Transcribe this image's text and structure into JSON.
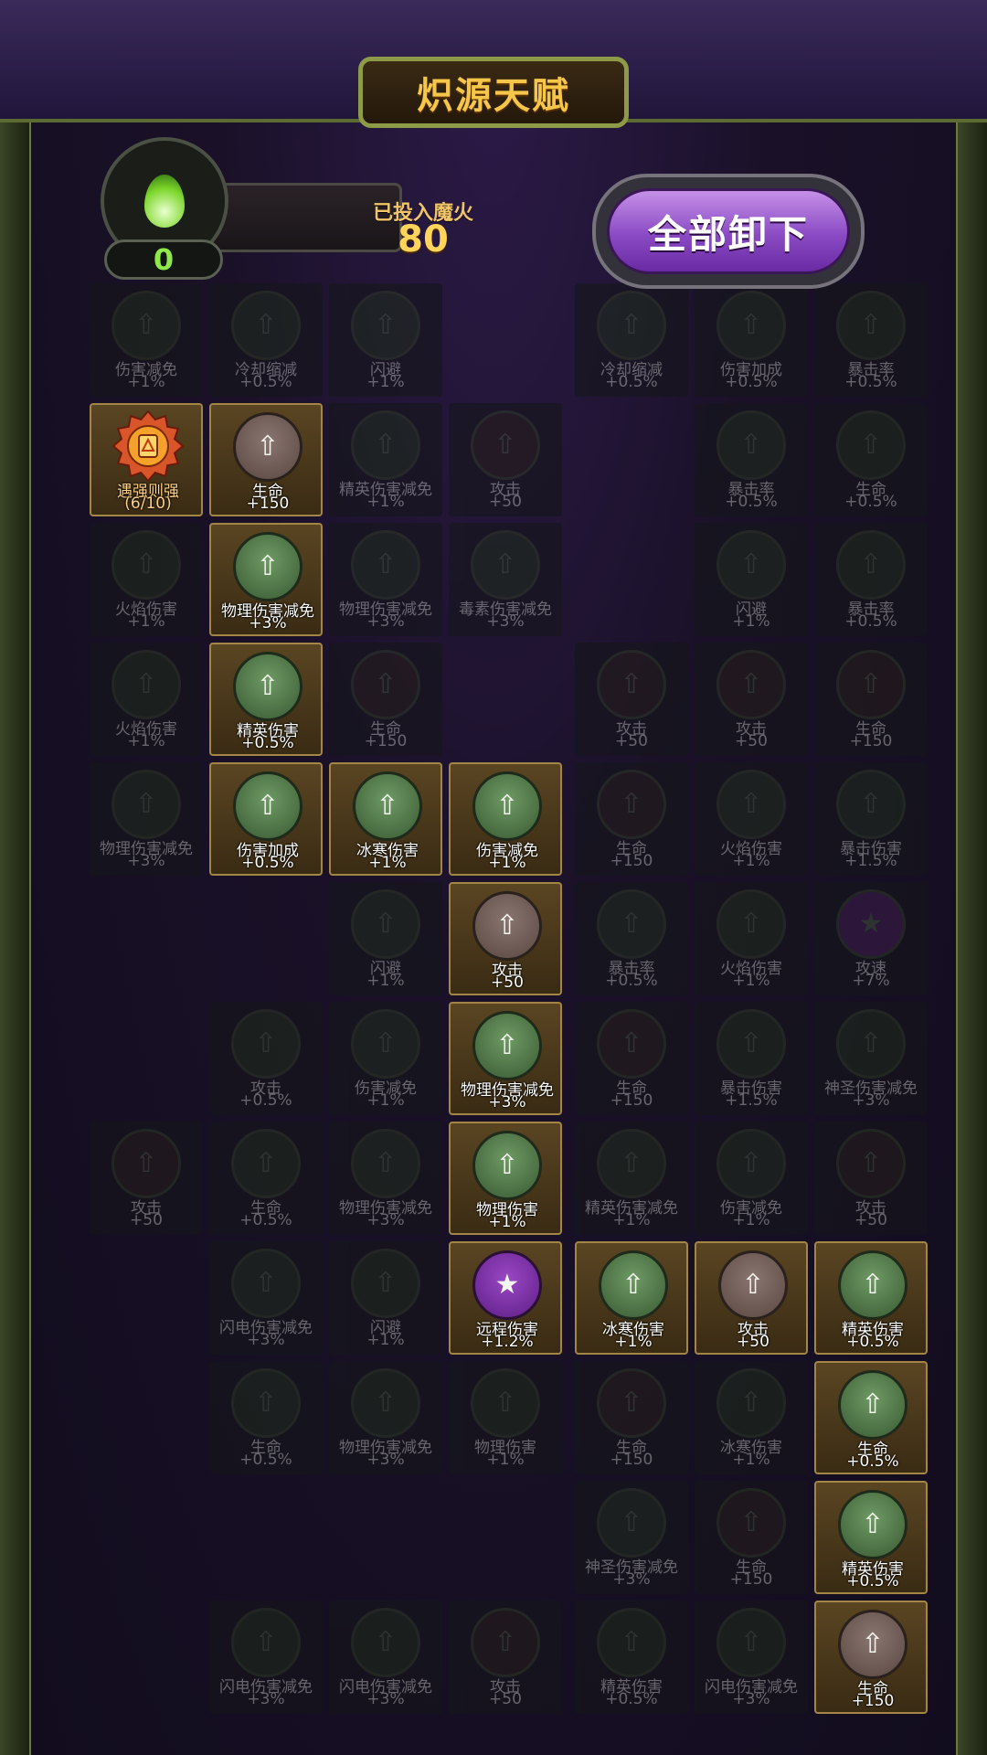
{
  "header": {
    "title": "炽源天赋"
  },
  "fire": {
    "count": "0",
    "invested_label": "已投入魔火",
    "invested_value": "80"
  },
  "actions": {
    "unequip_all": "全部卸下"
  },
  "colors": {
    "accent_gold": "#f6c64a",
    "fire_green": "#8ee84a",
    "button_purple": "#8a4ac4"
  },
  "tiles": [
    {
      "name": "伤害减免",
      "value": "+1%",
      "state": "dim",
      "orb": "green"
    },
    {
      "name": "冷却缩减",
      "value": "+0.5%",
      "state": "dim",
      "orb": "green"
    },
    {
      "name": "闪避",
      "value": "+1%",
      "state": "dim",
      "orb": "green"
    },
    {
      "name": "冷却缩减",
      "value": "+0.5%",
      "state": "dim",
      "orb": "green"
    },
    {
      "name": "伤害加成",
      "value": "+0.5%",
      "state": "dim",
      "orb": "green"
    },
    {
      "name": "暴击率",
      "value": "+0.5%",
      "state": "dim",
      "orb": "green"
    },
    {
      "name": "遇强则强",
      "value": "(6/10)",
      "state": "badge",
      "orb": "badge"
    },
    {
      "name": "生命",
      "value": "+150",
      "state": "on",
      "orb": "brown"
    },
    {
      "name": "精英伤害减免",
      "value": "+1%",
      "state": "dim",
      "orb": "green"
    },
    {
      "name": "攻击",
      "value": "+50",
      "state": "dim",
      "orb": "brown"
    },
    {
      "name": "暴击率",
      "value": "+0.5%",
      "state": "dim",
      "orb": "green"
    },
    {
      "name": "生命",
      "value": "+0.5%",
      "state": "dim",
      "orb": "green"
    },
    {
      "name": "火焰伤害",
      "value": "+1%",
      "state": "dim",
      "orb": "green"
    },
    {
      "name": "物理伤害减免",
      "value": "+3%",
      "state": "on",
      "orb": "green"
    },
    {
      "name": "物理伤害减免",
      "value": "+3%",
      "state": "dim",
      "orb": "green"
    },
    {
      "name": "毒素伤害减免",
      "value": "+3%",
      "state": "dim",
      "orb": "green"
    },
    {
      "name": "闪避",
      "value": "+1%",
      "state": "dim",
      "orb": "green"
    },
    {
      "name": "暴击率",
      "value": "+0.5%",
      "state": "dim",
      "orb": "green"
    },
    {
      "name": "火焰伤害",
      "value": "+1%",
      "state": "dim",
      "orb": "green"
    },
    {
      "name": "精英伤害",
      "value": "+0.5%",
      "state": "on",
      "orb": "green"
    },
    {
      "name": "生命",
      "value": "+150",
      "state": "dim",
      "orb": "brown"
    },
    {
      "name": "攻击",
      "value": "+50",
      "state": "dim",
      "orb": "brown"
    },
    {
      "name": "攻击",
      "value": "+50",
      "state": "dim",
      "orb": "brown"
    },
    {
      "name": "生命",
      "value": "+150",
      "state": "dim",
      "orb": "brown"
    },
    {
      "name": "物理伤害减免",
      "value": "+3%",
      "state": "dim",
      "orb": "green"
    },
    {
      "name": "伤害加成",
      "value": "+0.5%",
      "state": "on",
      "orb": "green"
    },
    {
      "name": "冰寒伤害",
      "value": "+1%",
      "state": "on",
      "orb": "green"
    },
    {
      "name": "伤害减免",
      "value": "+1%",
      "state": "on",
      "orb": "green"
    },
    {
      "name": "生命",
      "value": "+150",
      "state": "dim",
      "orb": "brown"
    },
    {
      "name": "火焰伤害",
      "value": "+1%",
      "state": "dim",
      "orb": "green"
    },
    {
      "name": "暴击伤害",
      "value": "+1.5%",
      "state": "dim",
      "orb": "green"
    },
    {
      "name": "闪避",
      "value": "+1%",
      "state": "dim",
      "orb": "green"
    },
    {
      "name": "攻击",
      "value": "+50",
      "state": "on",
      "orb": "brown"
    },
    {
      "name": "暴击率",
      "value": "+0.5%",
      "state": "dim",
      "orb": "green"
    },
    {
      "name": "火焰伤害",
      "value": "+1%",
      "state": "dim",
      "orb": "green"
    },
    {
      "name": "攻速",
      "value": "+7%",
      "state": "dim",
      "orb": "purple"
    },
    {
      "name": "攻击",
      "value": "+0.5%",
      "state": "dim",
      "orb": "green"
    },
    {
      "name": "伤害减免",
      "value": "+1%",
      "state": "dim",
      "orb": "green"
    },
    {
      "name": "物理伤害减免",
      "value": "+3%",
      "state": "on",
      "orb": "green"
    },
    {
      "name": "生命",
      "value": "+150",
      "state": "dim",
      "orb": "brown"
    },
    {
      "name": "暴击伤害",
      "value": "+1.5%",
      "state": "dim",
      "orb": "green"
    },
    {
      "name": "神圣伤害减免",
      "value": "+3%",
      "state": "dim",
      "orb": "green"
    },
    {
      "name": "攻击",
      "value": "+50",
      "state": "dim",
      "orb": "brown"
    },
    {
      "name": "生命",
      "value": "+0.5%",
      "state": "dim",
      "orb": "green"
    },
    {
      "name": "物理伤害减免",
      "value": "+3%",
      "state": "dim",
      "orb": "green"
    },
    {
      "name": "物理伤害",
      "value": "+1%",
      "state": "on",
      "orb": "green"
    },
    {
      "name": "精英伤害减免",
      "value": "+1%",
      "state": "dim",
      "orb": "green"
    },
    {
      "name": "伤害减免",
      "value": "+1%",
      "state": "dim",
      "orb": "green"
    },
    {
      "name": "攻击",
      "value": "+50",
      "state": "dim",
      "orb": "brown"
    },
    {
      "name": "闪电伤害减免",
      "value": "+3%",
      "state": "dim",
      "orb": "green"
    },
    {
      "name": "闪避",
      "value": "+1%",
      "state": "dim",
      "orb": "green"
    },
    {
      "name": "远程伤害",
      "value": "+1.2%",
      "state": "on",
      "orb": "purple"
    },
    {
      "name": "冰寒伤害",
      "value": "+1%",
      "state": "on",
      "orb": "green"
    },
    {
      "name": "攻击",
      "value": "+50",
      "state": "on",
      "orb": "brown"
    },
    {
      "name": "精英伤害",
      "value": "+0.5%",
      "state": "on",
      "orb": "green"
    },
    {
      "name": "生命",
      "value": "+0.5%",
      "state": "dim",
      "orb": "green"
    },
    {
      "name": "物理伤害减免",
      "value": "+3%",
      "state": "dim",
      "orb": "green"
    },
    {
      "name": "物理伤害",
      "value": "+1%",
      "state": "dim",
      "orb": "green"
    },
    {
      "name": "生命",
      "value": "+150",
      "state": "dim",
      "orb": "brown"
    },
    {
      "name": "冰寒伤害",
      "value": "+1%",
      "state": "dim",
      "orb": "green"
    },
    {
      "name": "生命",
      "value": "+0.5%",
      "state": "on",
      "orb": "green"
    },
    {
      "name": "神圣伤害减免",
      "value": "+3%",
      "state": "dim",
      "orb": "green"
    },
    {
      "name": "生命",
      "value": "+150",
      "state": "dim",
      "orb": "brown"
    },
    {
      "name": "精英伤害",
      "value": "+0.5%",
      "state": "on",
      "orb": "green"
    },
    {
      "name": "闪电伤害减免",
      "value": "+3%",
      "state": "dim",
      "orb": "green"
    },
    {
      "name": "闪电伤害减免",
      "value": "+3%",
      "state": "dim",
      "orb": "green"
    },
    {
      "name": "攻击",
      "value": "+50",
      "state": "dim",
      "orb": "brown"
    },
    {
      "name": "精英伤害",
      "value": "+0.5%",
      "state": "dim",
      "orb": "green"
    },
    {
      "name": "闪电伤害减免",
      "value": "+3%",
      "state": "dim",
      "orb": "green"
    },
    {
      "name": "生命",
      "value": "+150",
      "state": "on",
      "orb": "brown"
    }
  ]
}
